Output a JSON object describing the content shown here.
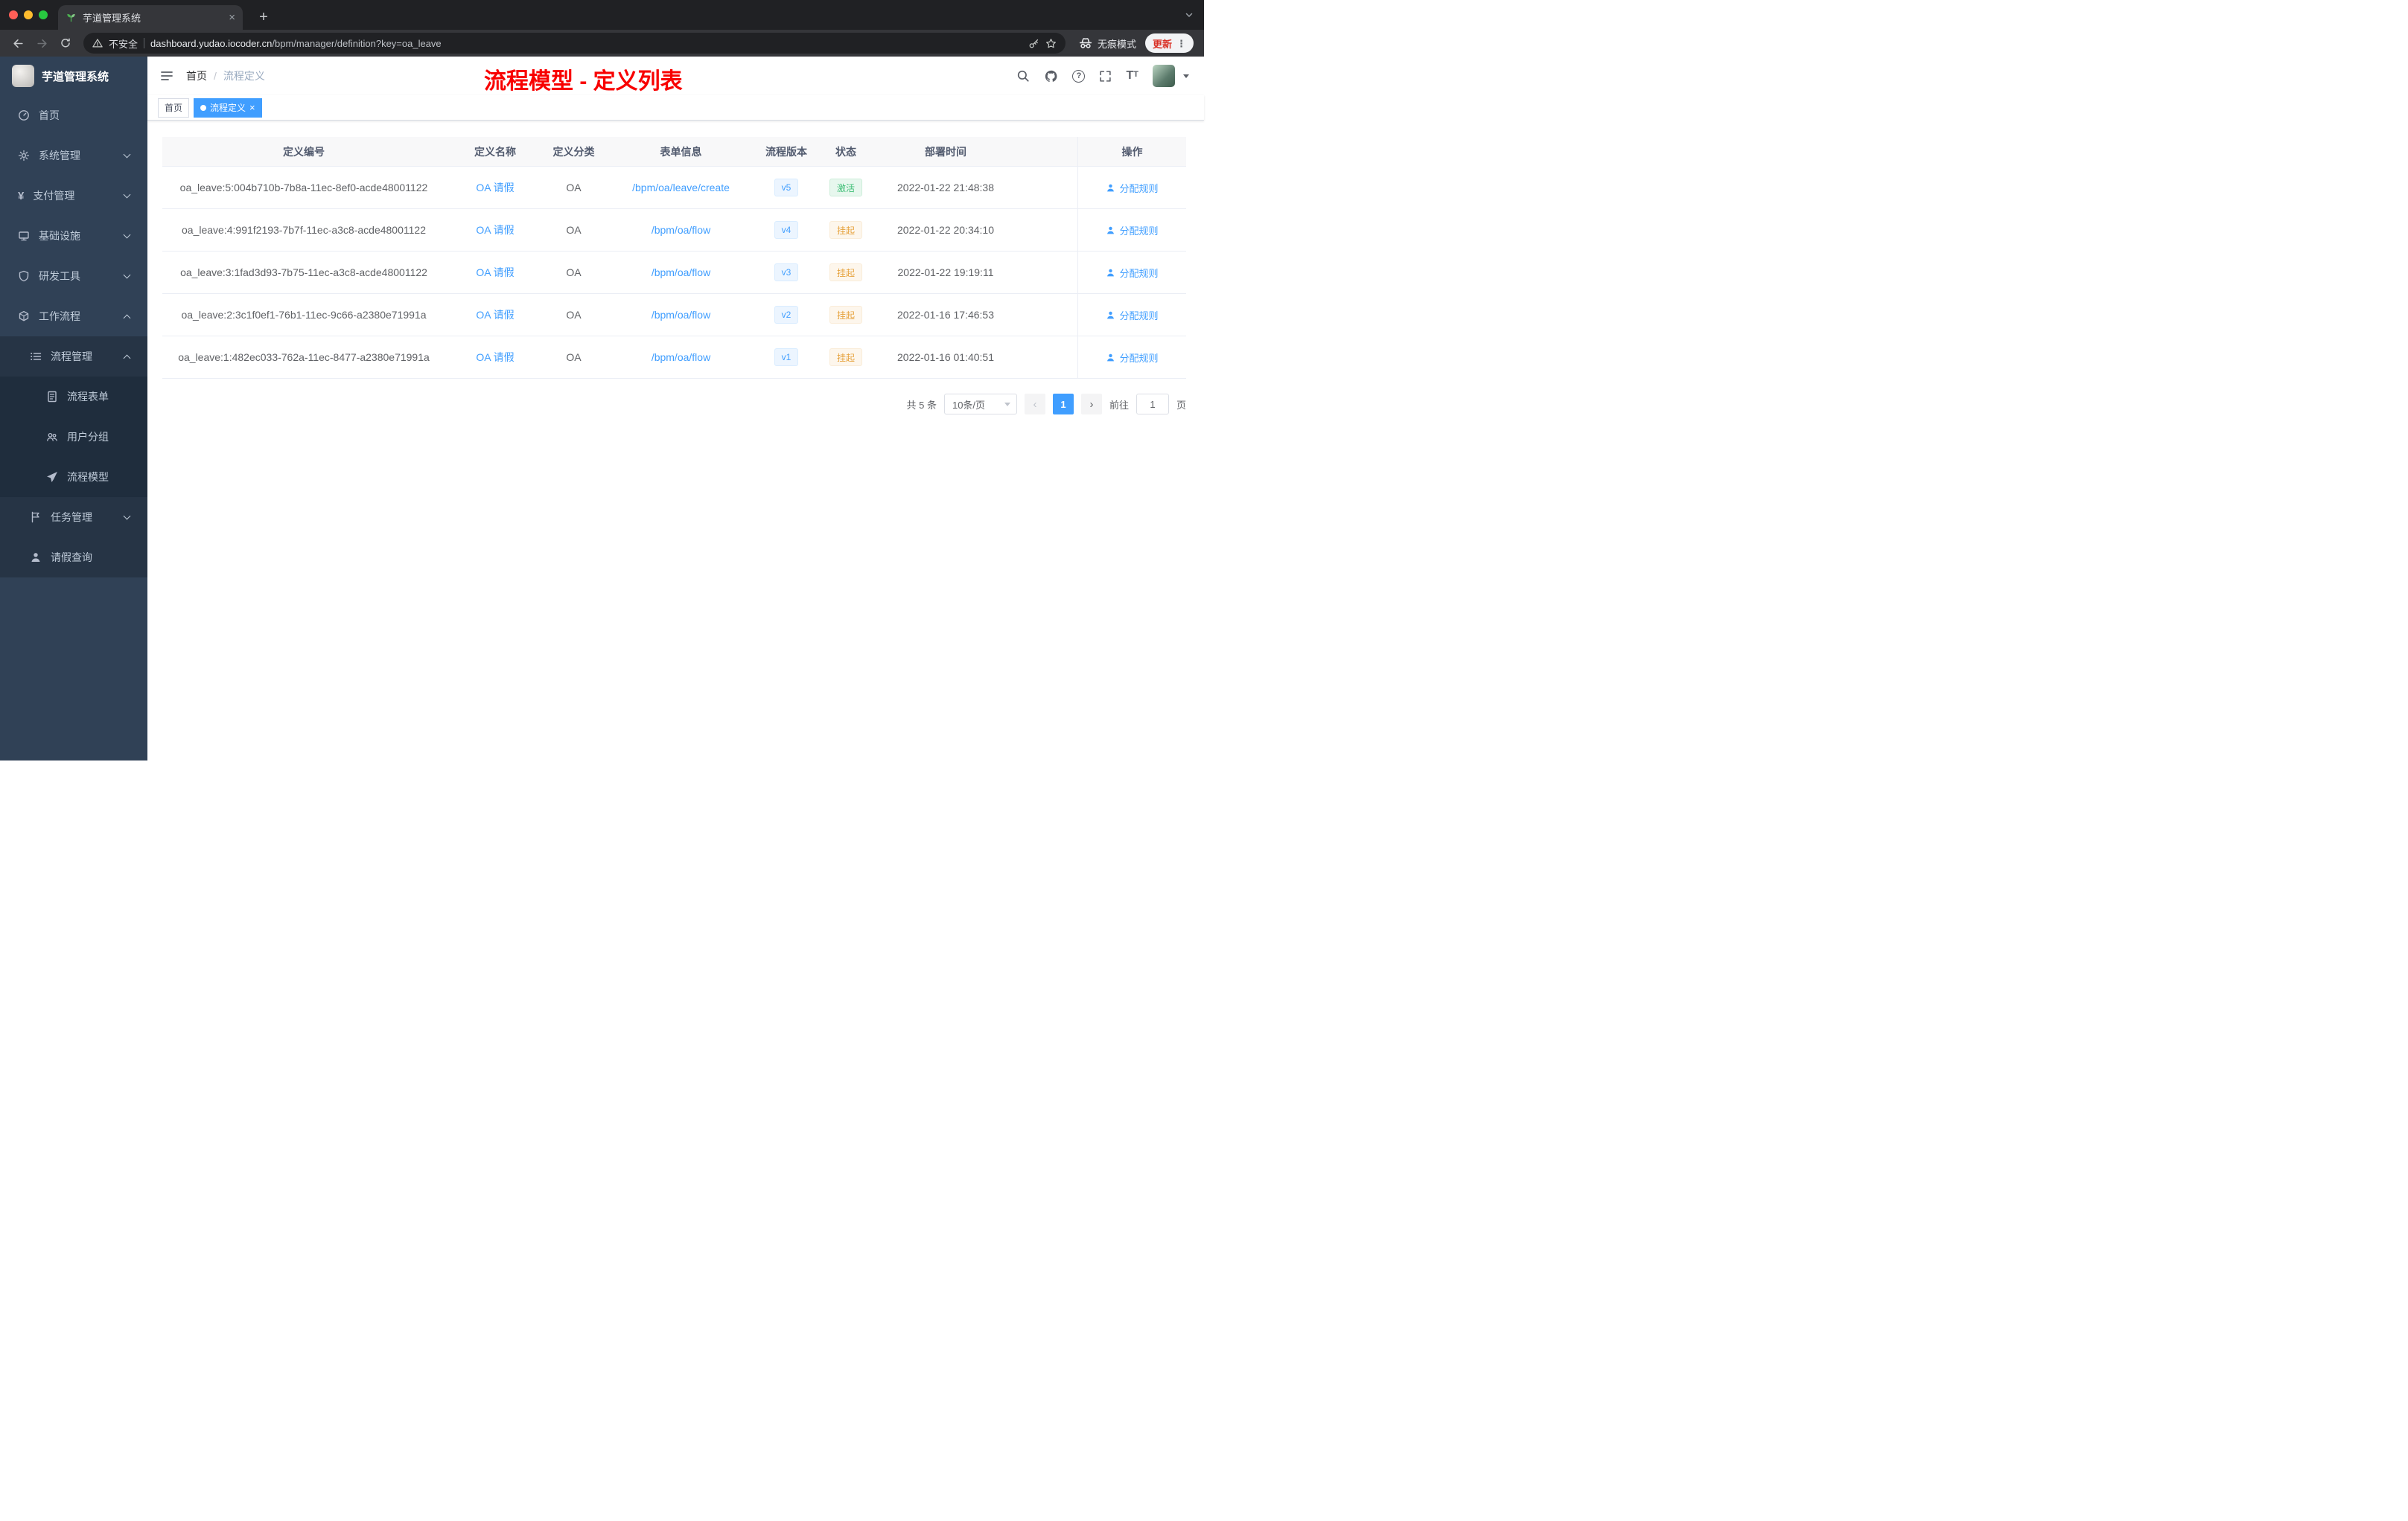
{
  "browser": {
    "tab_title": "芋道管理系统",
    "security_label": "不安全",
    "url_domain": "dashboard.yudao.iocoder.cn",
    "url_path": "/bpm/manager/definition?key=oa_leave",
    "incognito_label": "无痕模式",
    "update_label": "更新"
  },
  "sidebar": {
    "logo_title": "芋道管理系统",
    "items": [
      {
        "label": "首页",
        "icon": "dashboard-icon"
      },
      {
        "label": "系统管理",
        "icon": "gear-icon"
      },
      {
        "label": "支付管理",
        "icon": "yen-icon"
      },
      {
        "label": "基础设施",
        "icon": "monitor-icon"
      },
      {
        "label": "研发工具",
        "icon": "shield-icon"
      },
      {
        "label": "工作流程",
        "icon": "cube-icon"
      },
      {
        "label": "流程管理",
        "icon": "list-icon"
      },
      {
        "label": "流程表单",
        "icon": "document-icon"
      },
      {
        "label": "用户分组",
        "icon": "users-icon"
      },
      {
        "label": "流程模型",
        "icon": "paper-plane-icon"
      },
      {
        "label": "任务管理",
        "icon": "flag-icon"
      },
      {
        "label": "请假查询",
        "icon": "user-icon"
      }
    ]
  },
  "header": {
    "breadcrumb_home": "首页",
    "breadcrumb_separator": "/",
    "breadcrumb_current": "流程定义",
    "annotation_title": "流程模型 - 定义列表"
  },
  "tags": [
    {
      "label": "首页",
      "active": false
    },
    {
      "label": "流程定义",
      "active": true
    }
  ],
  "table": {
    "columns": [
      "定义编号",
      "定义名称",
      "定义分类",
      "表单信息",
      "流程版本",
      "状态",
      "部署时间",
      "操作"
    ],
    "rows": [
      {
        "id": "oa_leave:5:004b710b-7b8a-11ec-8ef0-acde48001122",
        "name": "OA 请假",
        "category": "OA",
        "form": "/bpm/oa/leave/create",
        "version": "v5",
        "status": "激活",
        "status_type": "active",
        "deploy_time": "2022-01-22 21:48:38",
        "action": "分配规则"
      },
      {
        "id": "oa_leave:4:991f2193-7b7f-11ec-a3c8-acde48001122",
        "name": "OA 请假",
        "category": "OA",
        "form": "/bpm/oa/flow",
        "version": "v4",
        "status": "挂起",
        "status_type": "suspended",
        "deploy_time": "2022-01-22 20:34:10",
        "action": "分配规则"
      },
      {
        "id": "oa_leave:3:1fad3d93-7b75-11ec-a3c8-acde48001122",
        "name": "OA 请假",
        "category": "OA",
        "form": "/bpm/oa/flow",
        "version": "v3",
        "status": "挂起",
        "status_type": "suspended",
        "deploy_time": "2022-01-22 19:19:11",
        "action": "分配规则"
      },
      {
        "id": "oa_leave:2:3c1f0ef1-76b1-11ec-9c66-a2380e71991a",
        "name": "OA 请假",
        "category": "OA",
        "form": "/bpm/oa/flow",
        "version": "v2",
        "status": "挂起",
        "status_type": "suspended",
        "deploy_time": "2022-01-16 17:46:53",
        "action": "分配规则"
      },
      {
        "id": "oa_leave:1:482ec033-762a-11ec-8477-a2380e71991a",
        "name": "OA 请假",
        "category": "OA",
        "form": "/bpm/oa/flow",
        "version": "v1",
        "status": "挂起",
        "status_type": "suspended",
        "deploy_time": "2022-01-16 01:40:51",
        "action": "分配规则"
      }
    ]
  },
  "pagination": {
    "total": "共 5 条",
    "page_size": "10条/页",
    "current_page": "1",
    "jump_prefix": "前往",
    "jump_value": "1",
    "jump_suffix": "页"
  },
  "colors": {
    "accent_blue": "#409eff",
    "annotation_red": "#f80000",
    "status_active_green": "#3fbf77",
    "status_suspended_orange": "#e6a23c",
    "sidebar_bg": "#304156"
  },
  "icons": {
    "browser": [
      "back-icon",
      "forward-icon",
      "reload-icon",
      "warning-icon",
      "key-icon",
      "star-icon",
      "incognito-icon",
      "kebab-icon"
    ],
    "header": [
      "hamburger-icon",
      "search-icon",
      "github-icon",
      "question-icon",
      "fullscreen-icon",
      "font-size-icon",
      "caret-down-icon"
    ]
  }
}
